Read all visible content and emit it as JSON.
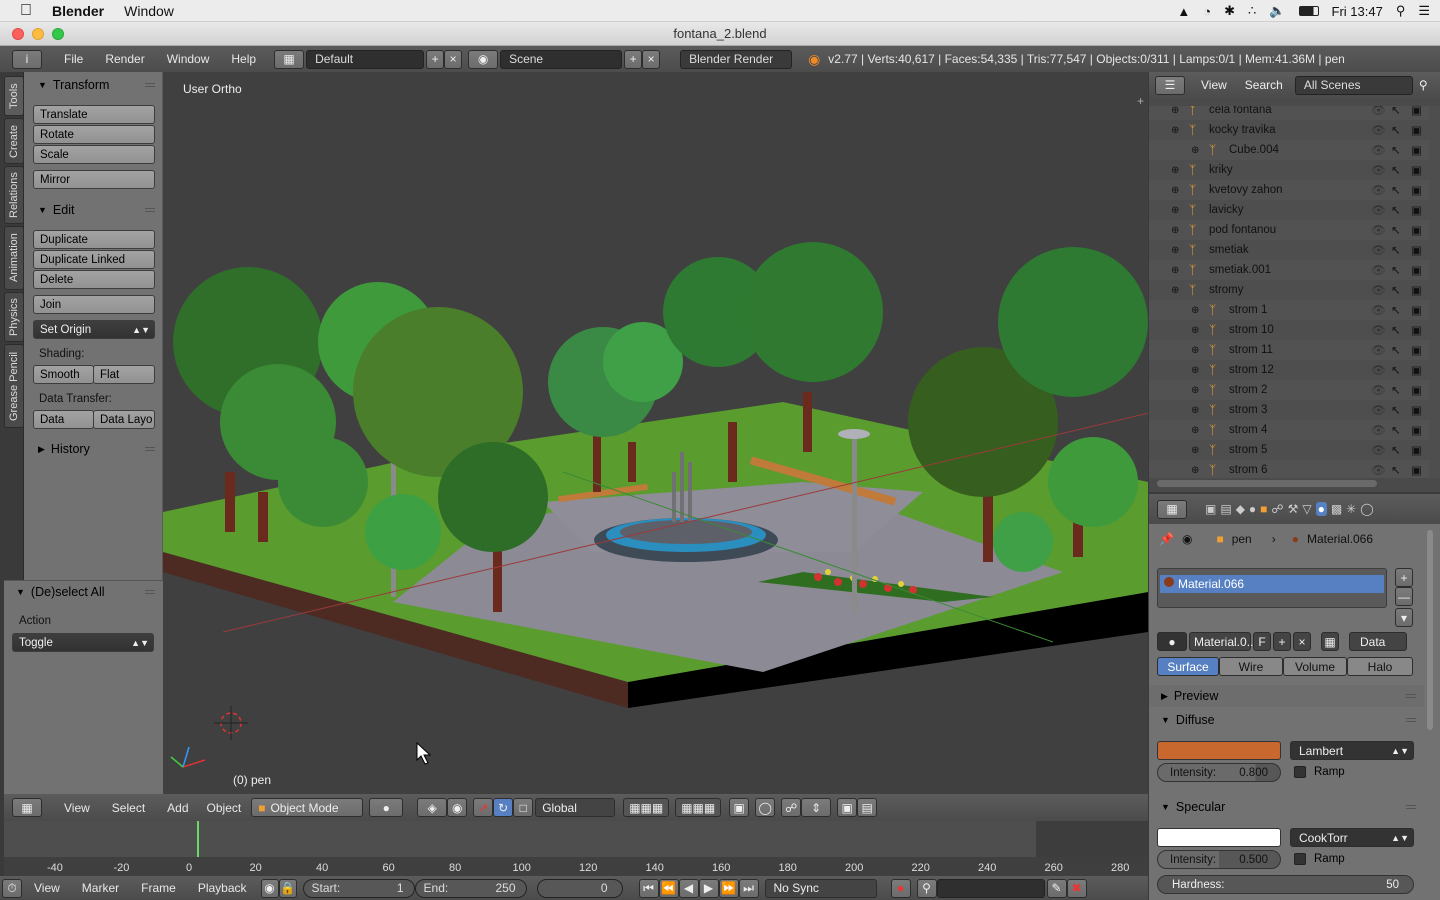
{
  "macbar": {
    "app": "Blender",
    "menu_window": "Window",
    "clock": "Fri 13:47"
  },
  "window": {
    "title": "fontana_2.blend"
  },
  "info": {
    "menus": [
      "File",
      "Render",
      "Window",
      "Help"
    ],
    "layout": "Default",
    "scene": "Scene",
    "engine": "Blender Render",
    "stats": "v2.77 | Verts:40,617 | Faces:54,335 | Tris:77,547 | Objects:0/311 | Lamps:0/1 | Mem:41.36M | pen"
  },
  "tabs": [
    "Tools",
    "Create",
    "Relations",
    "Animation",
    "Physics",
    "Grease Pencil"
  ],
  "toolshelf": {
    "transform": {
      "title": "Transform",
      "buttons": [
        "Translate",
        "Rotate",
        "Scale"
      ],
      "mirror": "Mirror"
    },
    "edit": {
      "title": "Edit",
      "dup": "Duplicate",
      "dup_linked": "Duplicate Linked",
      "delete": "Delete",
      "join": "Join",
      "set_origin": "Set Origin",
      "shading_label": "Shading:",
      "smooth": "Smooth",
      "flat": "Flat",
      "data_transfer_label": "Data Transfer:",
      "data": "Data",
      "data_layout": "Data Layo"
    },
    "history": "History"
  },
  "operator": {
    "title": "(De)select All",
    "action_label": "Action",
    "action_value": "Toggle"
  },
  "viewport": {
    "view_name": "User Ortho",
    "object_label": "(0) pen"
  },
  "outliner": {
    "view": "View",
    "search": "Search",
    "filter": "All Scenes",
    "rows": [
      {
        "name": "cela fontana",
        "level": 0
      },
      {
        "name": "kocky travika",
        "level": 0
      },
      {
        "name": "Cube.004",
        "level": 1
      },
      {
        "name": "kriky",
        "level": 0
      },
      {
        "name": "kvetovy zahon",
        "level": 0
      },
      {
        "name": "lavicky",
        "level": 0
      },
      {
        "name": "pod fontanou",
        "level": 0
      },
      {
        "name": "smetiak",
        "level": 0
      },
      {
        "name": "smetiak.001",
        "level": 0
      },
      {
        "name": "stromy",
        "level": 0
      },
      {
        "name": "strom 1",
        "level": 1
      },
      {
        "name": "strom 10",
        "level": 1
      },
      {
        "name": "strom 11",
        "level": 1
      },
      {
        "name": "strom 12",
        "level": 1
      },
      {
        "name": "strom 2",
        "level": 1
      },
      {
        "name": "strom 3",
        "level": 1
      },
      {
        "name": "strom 4",
        "level": 1
      },
      {
        "name": "strom 5",
        "level": 1
      },
      {
        "name": "strom 6",
        "level": 1
      }
    ]
  },
  "props": {
    "crumb_obj": "pen",
    "crumb_mat": "Material.066",
    "slot": "Material.066",
    "mat_name": "Material.0...",
    "fake": "F",
    "link": "Data",
    "tabs": [
      "Surface",
      "Wire",
      "Volume",
      "Halo"
    ],
    "preview": "Preview",
    "diffuse": {
      "title": "Diffuse",
      "color": "#c8682e",
      "shader": "Lambert",
      "intensity_label": "Intensity:",
      "intensity": "0.800",
      "ramp": "Ramp"
    },
    "specular": {
      "title": "Specular",
      "color": "#ffffff",
      "shader": "CookTorr",
      "intensity_label": "Intensity:",
      "intensity": "0.500",
      "ramp": "Ramp",
      "hardness_label": "Hardness:",
      "hardness": "50"
    }
  },
  "vhdr": {
    "menus": [
      "View",
      "Select",
      "Add",
      "Object"
    ],
    "mode": "Object Mode",
    "orientation": "Global"
  },
  "timeline": {
    "ticks": [
      "-40",
      "-20",
      "0",
      "20",
      "40",
      "60",
      "80",
      "100",
      "120",
      "140",
      "160",
      "180",
      "200",
      "220",
      "240",
      "260",
      "280"
    ],
    "menus": [
      "View",
      "Marker",
      "Frame",
      "Playback"
    ],
    "start_label": "Start:",
    "start": "1",
    "end_label": "End:",
    "end": "250",
    "current": "0",
    "sync": "No Sync"
  }
}
